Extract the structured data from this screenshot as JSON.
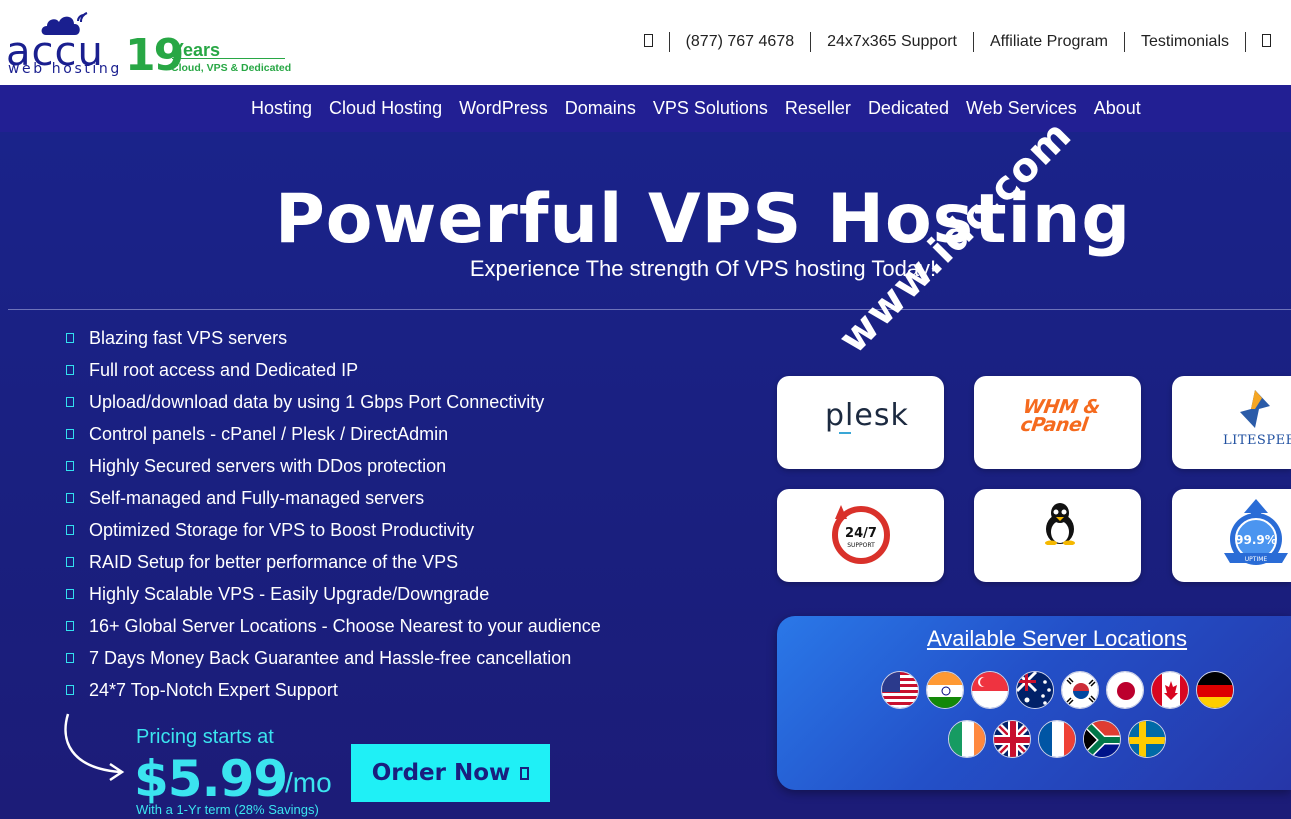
{
  "header": {
    "logo": {
      "brand": "accu",
      "sub": "web hosting",
      "years_number": "19",
      "years_label": "Years",
      "tagline": "Cloud, VPS & Dedicated"
    },
    "phone": "(877) 767 4678",
    "support": "24x7x365 Support",
    "affiliate": "Affiliate Program",
    "testimonials": "Testimonials"
  },
  "nav": {
    "items": [
      "Hosting",
      "Cloud Hosting",
      "WordPress",
      "Domains",
      "VPS Solutions",
      "Reseller",
      "Dedicated",
      "Web Services",
      "About"
    ]
  },
  "hero": {
    "title": "Powerful VPS Hosting",
    "subtitle": "Experience The strength Of VPS hosting Today!",
    "features": [
      "Blazing fast VPS servers",
      "Full root access and Dedicated IP",
      "Upload/download data by using 1 Gbps Port Connectivity",
      "Control panels - cPanel / Plesk / DirectAdmin",
      "Highly Secured servers with DDos protection",
      "Self-managed and Fully-managed servers",
      "Optimized Storage for VPS to Boost Productivity",
      "RAID Setup for better performance of the VPS",
      "Highly Scalable VPS - Easily Upgrade/Downgrade",
      "16+ Global Server Locations - Choose Nearest to your audience",
      "7 Days Money Back Guarantee and Hassle-free cancellation",
      "24*7 Top-Notch Expert Support"
    ],
    "pricing_label": "Pricing starts at",
    "price": "$5.99",
    "price_period": "/mo",
    "price_note": "With a 1-Yr term (28% Savings)",
    "order_button": "Order Now"
  },
  "cards": {
    "plesk": "plesk",
    "whm_line1": "WHM &",
    "whm_line2": "cPanel",
    "litespeed": "LITESPEED",
    "support_247": "24/7",
    "support_word": "SUPPORT",
    "uptime_value": "99.9%",
    "uptime_word": "UPTIME"
  },
  "locations": {
    "title": "Available Server Locations",
    "flags_row1": [
      "United States",
      "India",
      "Singapore",
      "Australia",
      "South Korea",
      "Japan",
      "Canada",
      "Germany"
    ],
    "flags_row2": [
      "Ireland",
      "United Kingdom",
      "France",
      "South Africa",
      "Sweden"
    ]
  },
  "watermark": "www.idc.com",
  "colors": {
    "nav_bg": "#221f93",
    "hero_bg": "#1a1f7e",
    "accent_cyan": "#1ff0f6",
    "brand_green": "#28a745",
    "brand_navy": "#1a1f8f"
  }
}
